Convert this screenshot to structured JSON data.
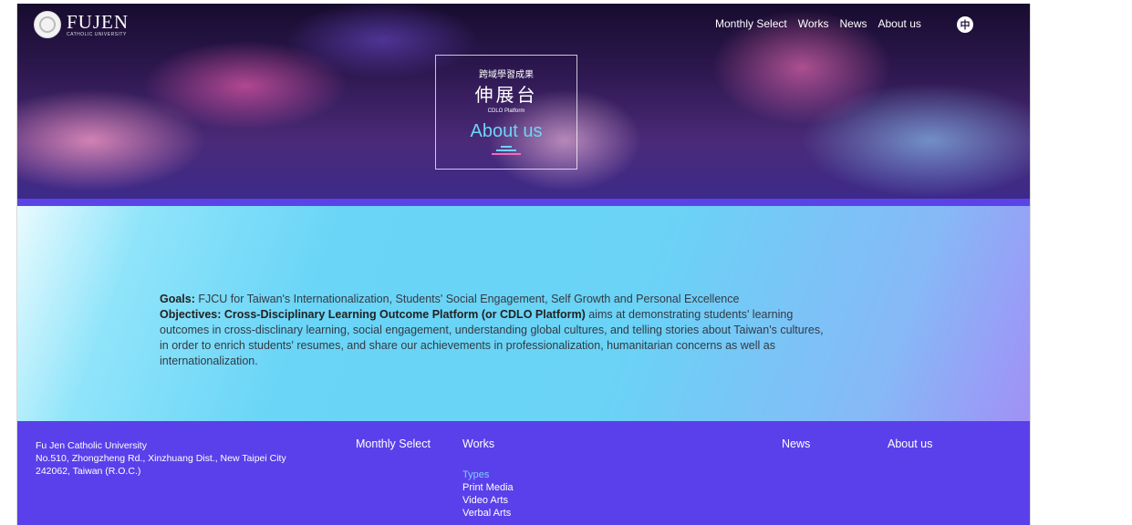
{
  "header": {
    "logo": {
      "name": "FUJEN",
      "subtitle": "CATHOLIC UNIVERSITY"
    },
    "nav": [
      "Monthly Select",
      "Works",
      "News",
      "About us"
    ],
    "language_button": "中"
  },
  "hero": {
    "title_small": "跨域學習成果",
    "title_big": "伸展台",
    "title_en": "CDLO Platform",
    "page_heading": "About us"
  },
  "about": {
    "goals_label": "Goals:",
    "goals_text": " FJCU for Taiwan's Internationalization, Students' Social Engagement, Self Growth and Personal Excellence",
    "objectives_label": "Objectives: Cross-Disciplinary Learning Outcome Platform (or CDLO Platform)",
    "objectives_text": " aims at demonstrating students' learning outcomes in cross-disclinary learning, social engagement, understanding global cultures, and telling stories about Taiwan's cultures, in order to enrich students' resumes, and share our achievements in professionalization, humanitarian concerns as well as internationalization."
  },
  "footer": {
    "address": {
      "line1": "Fu Jen Catholic University",
      "line2": "No.510, Zhongzheng Rd., Xinzhuang Dist., New Taipei City",
      "line3": "242062, Taiwan (R.O.C.)"
    },
    "monthly_select": "Monthly Select",
    "works": "Works",
    "news": "News",
    "about_us": "About us",
    "works_category": "Types",
    "works_items": [
      "Print Media",
      "Video Arts",
      "Verbal Arts"
    ]
  },
  "colors": {
    "accent_cyan": "#6fd3f7",
    "footer_purple": "#5a40ea",
    "accent_pink": "#f06bb8"
  }
}
